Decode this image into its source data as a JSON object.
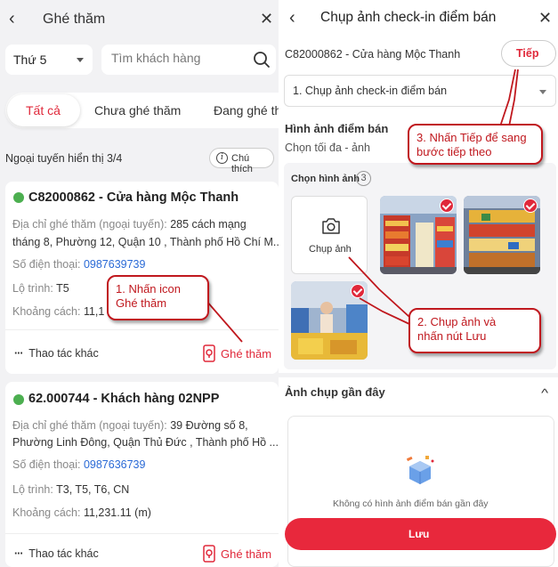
{
  "left": {
    "header": {
      "title": "Ghé thăm"
    },
    "filter": {
      "day": "Thứ 5",
      "search_placeholder": "Tìm khách hàng"
    },
    "tabs": [
      {
        "label": "Tất cả",
        "active": true
      },
      {
        "label": "Chưa ghé thăm"
      },
      {
        "label": "Đang ghé th"
      }
    ],
    "offline_text": "Ngoại tuyến hiển thị 3/4",
    "legend_label": "Chú thích",
    "customers": [
      {
        "name": "C82000862 - Cửa hàng Mộc Thanh",
        "address_label": "Địa chỉ ghé thăm (ngoại tuyến):",
        "address_line1": "285 cách mạng",
        "address_line2": "tháng 8, Phường 12, Quận 10 , Thành phố Hồ Chí M...",
        "phone_label": "Số điện thoại:",
        "phone": "0987639739",
        "route_label": "Lộ trình:",
        "route": "T5",
        "distance_label": "Khoảng cách:",
        "distance": "11,1",
        "more_label": "Thao tác khác",
        "visit_label": "Ghé thăm",
        "status_color": "#4caf50"
      },
      {
        "name": "62.000744 - Khách hàng 02NPP",
        "address_label": "Địa chỉ ghé thăm (ngoại tuyến):",
        "address_line1": "39 Đường số 8,",
        "address_line2": "Phường Linh Đông, Quận Thủ Đức , Thành phố Hồ ...",
        "phone_label": "Số điện thoại:",
        "phone": "0987636739",
        "route_label": "Lộ trình:",
        "route": "T3, T5, T6, CN",
        "distance_label": "Khoảng cách:",
        "distance": "11,231.11 (m)",
        "more_label": "Thao tác khác",
        "visit_label": "Ghé thăm",
        "status_color": "#4caf50"
      }
    ]
  },
  "right": {
    "header": {
      "title": "Chụp ảnh check-in điểm bán"
    },
    "store": "C82000862 - Cửa hàng Mộc Thanh",
    "next_label": "Tiếp",
    "step": "1. Chụp ảnh check-in điểm bán",
    "section_title": "Hình ảnh điểm bán",
    "section_sub": "Chọn tối đa - ảnh",
    "select_images_label": "Chọn hình ảnh",
    "selected_count": "3",
    "capture_label": "Chụp ảnh",
    "recent_title": "Ảnh chụp gần đây",
    "recent_empty": "Không có hình ảnh điểm bán gần đây",
    "save_label": "Lưu"
  },
  "callouts": {
    "c1": {
      "line1": "1. Nhấn icon",
      "line2": "Ghé thăm"
    },
    "c2": {
      "line1": "2. Chụp ảnh và",
      "line2": "nhấn nút Lưu"
    },
    "c3": {
      "line1": "3. Nhấn Tiếp để sang",
      "line2": "bước tiếp theo"
    }
  },
  "colors": {
    "accent": "#e0283a",
    "callout": "#c0181e",
    "link": "#2a6ad6",
    "online": "#4caf50"
  }
}
